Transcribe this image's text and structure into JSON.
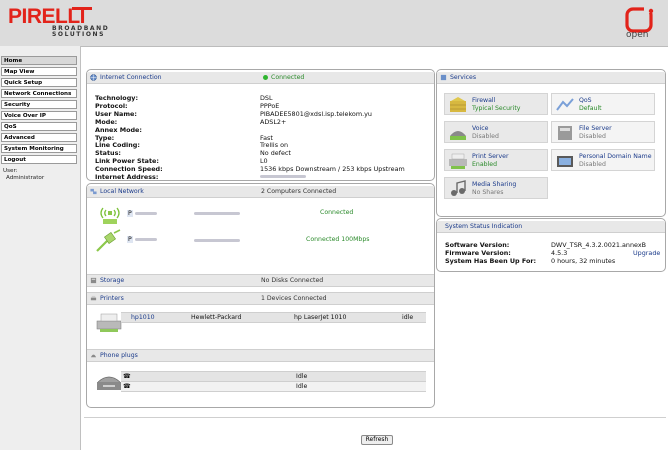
{
  "brand": {
    "name": "PIRELLI",
    "sub1": "BROADBAND",
    "sub2": "SOLUTIONS",
    "open_label": "open",
    "brand_color": "#e2231a"
  },
  "nav": [
    {
      "label": "Home"
    },
    {
      "label": "Map View"
    },
    {
      "label": "Quick Setup"
    },
    {
      "label": "Network Connections"
    },
    {
      "label": "Security"
    },
    {
      "label": "Voice Over IP"
    },
    {
      "label": "QoS"
    },
    {
      "label": "Advanced"
    },
    {
      "label": "System Monitoring"
    },
    {
      "label": "Logout"
    }
  ],
  "user": {
    "label": "User:",
    "name": "Administrator"
  },
  "internet": {
    "title": "Internet Connection",
    "status": "Connected",
    "rows": [
      {
        "k": "Technology:",
        "v": "DSL"
      },
      {
        "k": "Protocol:",
        "v": "PPPoE"
      },
      {
        "k": "User Name:",
        "v": "PIBADEE5801@xdsl.isp.telekom.yu"
      },
      {
        "k": "Mode:",
        "v": "ADSL2+"
      },
      {
        "k": "Annex Mode:",
        "v": ""
      },
      {
        "k": "Type:",
        "v": "Fast"
      },
      {
        "k": "Line Coding:",
        "v": "Trellis on"
      },
      {
        "k": "Status:",
        "v": "No defect"
      },
      {
        "k": "Link Power State:",
        "v": "L0"
      },
      {
        "k": "Connection Speed:",
        "v": "1536 kbps Downstream / 253 kbps Upstream"
      },
      {
        "k": "Internet Address:",
        "v": ""
      }
    ]
  },
  "local": {
    "title": "Local Network",
    "status": "2 Computers Connected",
    "devices": [
      {
        "prefix": "P",
        "status": "Connected"
      },
      {
        "prefix": "P",
        "status": "Connected 100Mbps"
      }
    ]
  },
  "storage": {
    "title": "Storage",
    "status": "No Disks Connected"
  },
  "printers": {
    "title": "Printers",
    "status": "1 Devices Connected",
    "rows": [
      {
        "name": "hp1010",
        "vendor": "Hewlett-Packard",
        "model": "hp LaserJet 1010",
        "state": "idle"
      }
    ]
  },
  "phone": {
    "title": "Phone plugs",
    "rows": [
      {
        "state": "Idle"
      },
      {
        "state": "Idle"
      }
    ]
  },
  "services": {
    "title": "Services",
    "items": [
      {
        "name": "Firewall",
        "status": "Typical Security",
        "on": true
      },
      {
        "name": "QoS",
        "status": "Default",
        "on": true
      },
      {
        "name": "Voice",
        "status": "Disabled",
        "on": false
      },
      {
        "name": "File Server",
        "status": "Disabled",
        "on": false
      },
      {
        "name": "Print Server",
        "status": "Enabled",
        "on": true
      },
      {
        "name": "Personal Domain Name",
        "status": "Disabled",
        "on": false
      },
      {
        "name": "Media Sharing",
        "status": "No Shares",
        "on": false
      }
    ]
  },
  "system": {
    "title": "System Status Indication",
    "software_label": "Software Version:",
    "software_value": "DWV_TSR_4.3.2.0021.annexB",
    "firmware_label": "Firmware Version:",
    "firmware_value": "4.5.3",
    "upgrade_label": "Upgrade",
    "uptime_label": "System Has Been Up For:",
    "uptime_value": "0 hours, 32 minutes"
  },
  "refresh_label": "Refresh"
}
